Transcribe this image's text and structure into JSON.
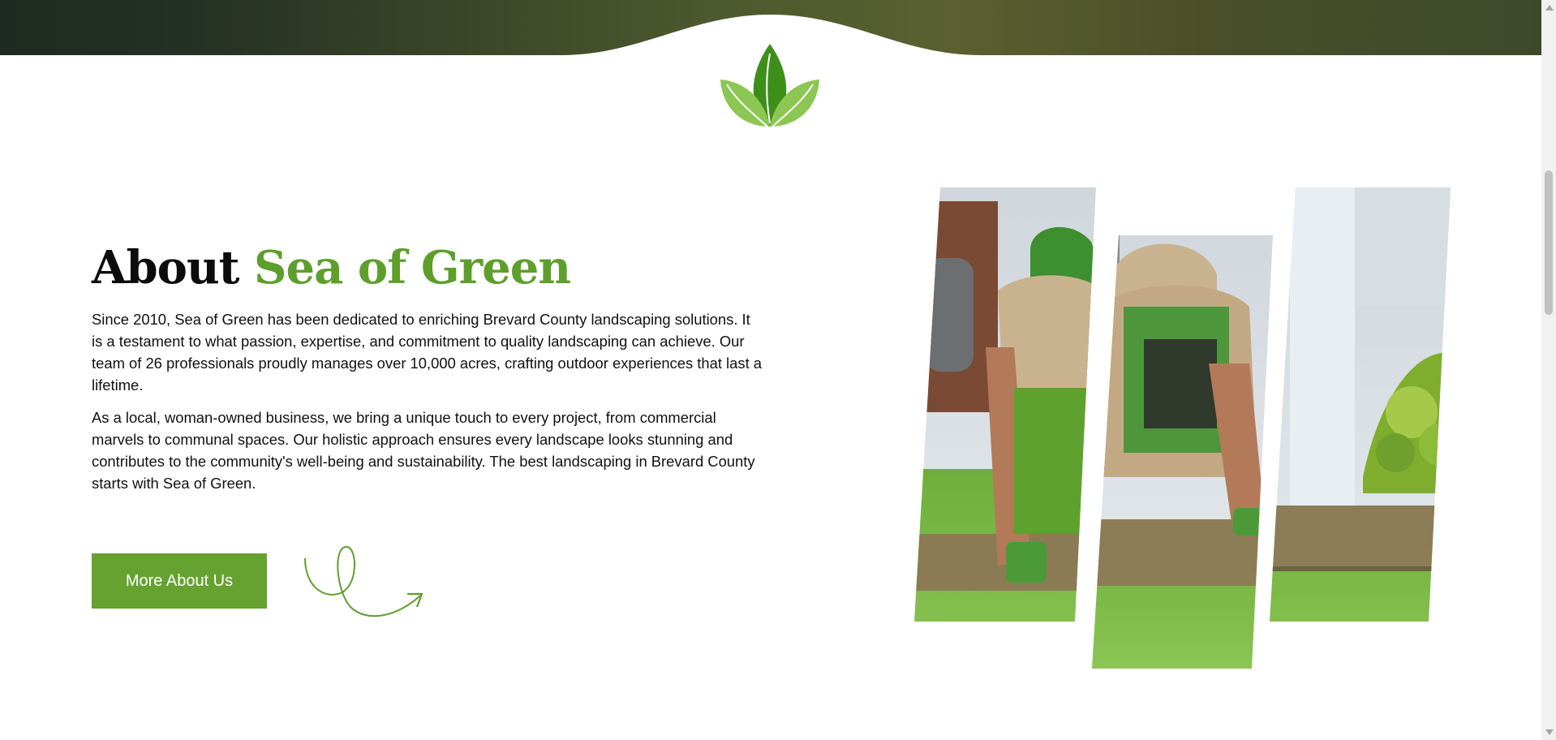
{
  "about": {
    "title_prefix": "About",
    "title_accent": "Sea of Green",
    "paragraph_1": "Since 2010, Sea of Green has been dedicated to enriching Brevard County landscaping solutions. It is a testament to what passion, expertise, and commitment to quality landscaping can achieve. Our team of 26 professionals proudly manages over 10,000 acres, crafting outdoor experiences that last a lifetime.",
    "paragraph_2": "As a local, woman-owned business, we bring a unique touch to every project, from commercial marvels to communal spaces. Our holistic approach ensures every landscape looks stunning and contributes to the community's well-being and sustainability. The best landscaping in Brevard County starts with Sea of Green.",
    "cta_label": "More About Us"
  },
  "icons": {
    "logo": "leaf-sprout-logo",
    "decor": "swirl-arrow-icon"
  },
  "colors": {
    "brand_green": "#5e9f2c",
    "button_green": "#66a22f",
    "header_dark": "#2c3526"
  }
}
